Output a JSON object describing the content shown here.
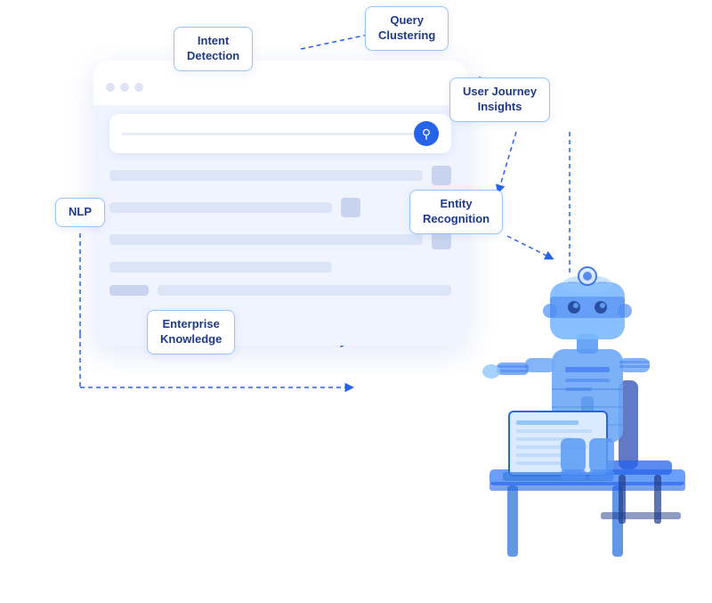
{
  "labels": {
    "intent_detection": "Intent\nDetection",
    "intent_detection_line1": "Intent",
    "intent_detection_line2": "Detection",
    "query_clustering_line1": "Query",
    "query_clustering_line2": "Clustering",
    "journey_line1": "User Journey",
    "journey_line2": "Insights",
    "entity_line1": "Entity",
    "entity_line2": "Recognition",
    "nlp": "NLP",
    "enterprise_line1": "Enterprise",
    "enterprise_line2": "Knowledge"
  },
  "colors": {
    "accent": "#2563eb",
    "label_border": "#93c5fd",
    "label_text": "#1e3a8a",
    "dashed": "#2563eb",
    "bg": "#f0f4ff"
  }
}
